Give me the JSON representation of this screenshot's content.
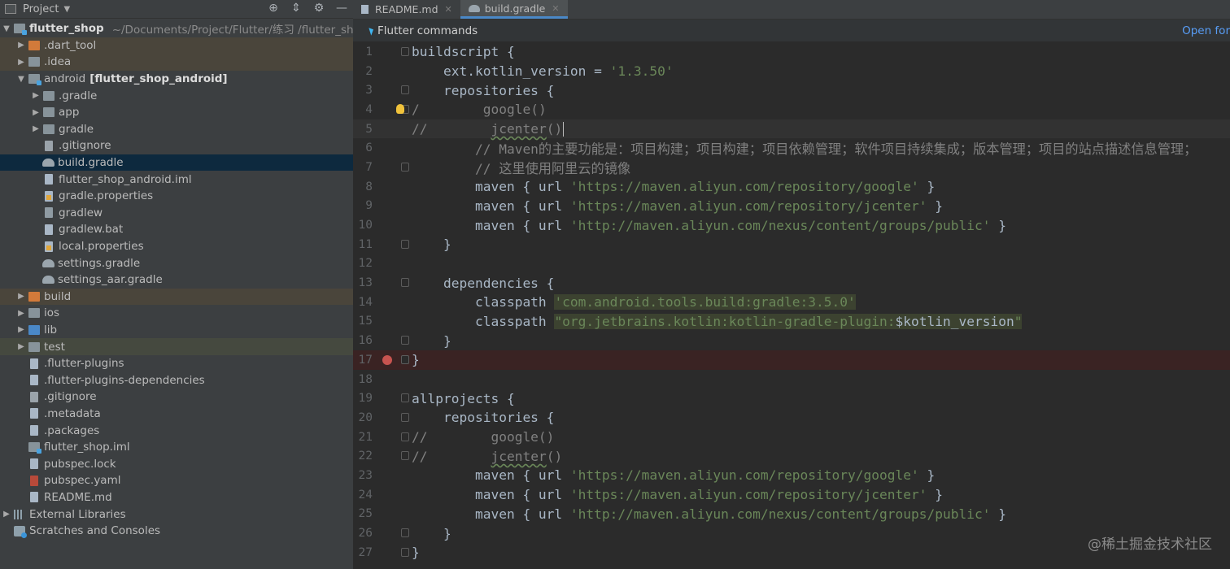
{
  "project_panel": {
    "title": "Project",
    "tree": [
      {
        "name": "flutter_shop",
        "path": "~/Documents/Project/Flutter/练习 /flutter_sho",
        "depth": 0,
        "expanded": true,
        "kind": "root"
      },
      {
        "name": ".dart_tool",
        "depth": 1,
        "expanded": false,
        "kind": "folder-orange",
        "hl": "brown"
      },
      {
        "name": ".idea",
        "depth": 1,
        "expanded": false,
        "kind": "folder",
        "hl": "brown"
      },
      {
        "name": "android",
        "module": "[flutter_shop_android]",
        "depth": 1,
        "expanded": true,
        "kind": "folder-mod"
      },
      {
        "name": ".gradle",
        "depth": 2,
        "expanded": false,
        "kind": "folder"
      },
      {
        "name": "app",
        "depth": 2,
        "expanded": false,
        "kind": "folder"
      },
      {
        "name": "gradle",
        "depth": 2,
        "expanded": false,
        "kind": "folder"
      },
      {
        "name": ".gitignore",
        "depth": 2,
        "kind": "git"
      },
      {
        "name": "build.gradle",
        "depth": 2,
        "kind": "gradle",
        "selected": true
      },
      {
        "name": "flutter_shop_android.iml",
        "depth": 2,
        "kind": "file"
      },
      {
        "name": "gradle.properties",
        "depth": 2,
        "kind": "props"
      },
      {
        "name": "gradlew",
        "depth": 2,
        "kind": "sh"
      },
      {
        "name": "gradlew.bat",
        "depth": 2,
        "kind": "file"
      },
      {
        "name": "local.properties",
        "depth": 2,
        "kind": "props"
      },
      {
        "name": "settings.gradle",
        "depth": 2,
        "kind": "gradle"
      },
      {
        "name": "settings_aar.gradle",
        "depth": 2,
        "kind": "gradle"
      },
      {
        "name": "build",
        "depth": 1,
        "expanded": false,
        "kind": "folder-orange",
        "hl": "brown"
      },
      {
        "name": "ios",
        "depth": 1,
        "expanded": false,
        "kind": "folder"
      },
      {
        "name": "lib",
        "depth": 1,
        "expanded": false,
        "kind": "folder-blue"
      },
      {
        "name": "test",
        "depth": 1,
        "expanded": false,
        "kind": "folder",
        "hl": "green"
      },
      {
        "name": ".flutter-plugins",
        "depth": 1,
        "kind": "file"
      },
      {
        "name": ".flutter-plugins-dependencies",
        "depth": 1,
        "kind": "file"
      },
      {
        "name": ".gitignore",
        "depth": 1,
        "kind": "git"
      },
      {
        "name": ".metadata",
        "depth": 1,
        "kind": "file"
      },
      {
        "name": ".packages",
        "depth": 1,
        "kind": "file"
      },
      {
        "name": "flutter_shop.iml",
        "depth": 1,
        "kind": "folder-mod"
      },
      {
        "name": "pubspec.lock",
        "depth": 1,
        "kind": "file"
      },
      {
        "name": "pubspec.yaml",
        "depth": 1,
        "kind": "yaml"
      },
      {
        "name": "README.md",
        "depth": 1,
        "kind": "file"
      },
      {
        "name": "External Libraries",
        "depth": 0,
        "expanded": false,
        "kind": "lib"
      },
      {
        "name": "Scratches and Consoles",
        "depth": 0,
        "kind": "scratch"
      }
    ]
  },
  "tabs": [
    {
      "label": "README.md",
      "active": false,
      "kind": "file"
    },
    {
      "label": "build.gradle",
      "active": true,
      "kind": "gradle"
    }
  ],
  "banner": {
    "title": "Flutter commands",
    "action": "Open for"
  },
  "code_lines": [
    {
      "n": "1",
      "fold": true,
      "parts": [
        [
          "tx",
          "buildscript {"
        ]
      ]
    },
    {
      "n": "2",
      "parts": [
        [
          "tx",
          "    ext.kotlin_version = "
        ],
        [
          "str",
          "'1.3.50'"
        ]
      ]
    },
    {
      "n": "3",
      "fold": true,
      "parts": [
        [
          "tx",
          "    repositories {"
        ]
      ]
    },
    {
      "n": "4",
      "fold": true,
      "bulb": true,
      "parts": [
        [
          "cm",
          "/        "
        ],
        [
          "cm",
          "google()"
        ]
      ]
    },
    {
      "n": "5",
      "cur": true,
      "caret": true,
      "parts": [
        [
          "cm",
          "//        "
        ],
        [
          "cmsq",
          "jcenter"
        ],
        [
          "cm",
          "()"
        ]
      ]
    },
    {
      "n": "6",
      "parts": [
        [
          "cm",
          "        // Maven的主要功能是：项目构建；项目构建；项目依赖管理；软件项目持续集成；版本管理；项目的站点描述信息管理；"
        ]
      ]
    },
    {
      "n": "7",
      "fold": true,
      "parts": [
        [
          "cm",
          "        // 这里使用阿里云的镜像"
        ]
      ]
    },
    {
      "n": "8",
      "parts": [
        [
          "tx",
          "        maven { url "
        ],
        [
          "str",
          "'https://maven.aliyun.com/repository/google'"
        ],
        [
          "tx",
          " }"
        ]
      ]
    },
    {
      "n": "9",
      "parts": [
        [
          "tx",
          "        maven { url "
        ],
        [
          "str",
          "'https://maven.aliyun.com/repository/jcenter'"
        ],
        [
          "tx",
          " }"
        ]
      ]
    },
    {
      "n": "10",
      "parts": [
        [
          "tx",
          "        maven { url "
        ],
        [
          "str",
          "'http://maven.aliyun.com/nexus/content/groups/public'"
        ],
        [
          "tx",
          " }"
        ]
      ]
    },
    {
      "n": "11",
      "fold": true,
      "parts": [
        [
          "tx",
          "    }"
        ]
      ]
    },
    {
      "n": "12",
      "parts": [
        [
          "tx",
          ""
        ]
      ]
    },
    {
      "n": "13",
      "fold": true,
      "parts": [
        [
          "tx",
          "    dependencies {"
        ]
      ]
    },
    {
      "n": "14",
      "parts": [
        [
          "tx",
          "        classpath "
        ],
        [
          "hl",
          "'com.android.tools.build:gradle:3.5.0'"
        ]
      ]
    },
    {
      "n": "15",
      "parts": [
        [
          "tx",
          "        classpath "
        ],
        [
          "hl",
          "\"org.jetbrains.kotlin:kotlin-gradle-plugin:"
        ],
        [
          "hlv",
          "$kotlin_version"
        ],
        [
          "hl",
          "\""
        ]
      ]
    },
    {
      "n": "16",
      "fold": true,
      "parts": [
        [
          "tx",
          "    }"
        ]
      ]
    },
    {
      "n": "17",
      "fold": true,
      "bp": true,
      "parts": [
        [
          "tx",
          "}"
        ]
      ]
    },
    {
      "n": "18",
      "parts": [
        [
          "tx",
          ""
        ]
      ]
    },
    {
      "n": "19",
      "fold": true,
      "parts": [
        [
          "tx",
          "allprojects {"
        ]
      ]
    },
    {
      "n": "20",
      "fold": true,
      "parts": [
        [
          "tx",
          "    repositories {"
        ]
      ]
    },
    {
      "n": "21",
      "fold": true,
      "parts": [
        [
          "cm",
          "//        google()"
        ]
      ]
    },
    {
      "n": "22",
      "fold": true,
      "parts": [
        [
          "cm",
          "//        "
        ],
        [
          "cmsq",
          "jcenter"
        ],
        [
          "cm",
          "()"
        ]
      ]
    },
    {
      "n": "23",
      "parts": [
        [
          "tx",
          "        maven { url "
        ],
        [
          "str",
          "'https://maven.aliyun.com/repository/google'"
        ],
        [
          "tx",
          " }"
        ]
      ]
    },
    {
      "n": "24",
      "parts": [
        [
          "tx",
          "        maven { url "
        ],
        [
          "str",
          "'https://maven.aliyun.com/repository/jcenter'"
        ],
        [
          "tx",
          " }"
        ]
      ]
    },
    {
      "n": "25",
      "parts": [
        [
          "tx",
          "        maven { url "
        ],
        [
          "str",
          "'http://maven.aliyun.com/nexus/content/groups/public'"
        ],
        [
          "tx",
          " }"
        ]
      ]
    },
    {
      "n": "26",
      "fold": true,
      "parts": [
        [
          "tx",
          "    }"
        ]
      ]
    },
    {
      "n": "27",
      "fold": true,
      "parts": [
        [
          "tx",
          "}"
        ]
      ]
    }
  ],
  "watermark": "@稀土掘金技术社区",
  "colors": {
    "accent": "#4a88c7",
    "string": "#6a8759",
    "comment": "#808080",
    "breakpoint": "#c75450"
  }
}
